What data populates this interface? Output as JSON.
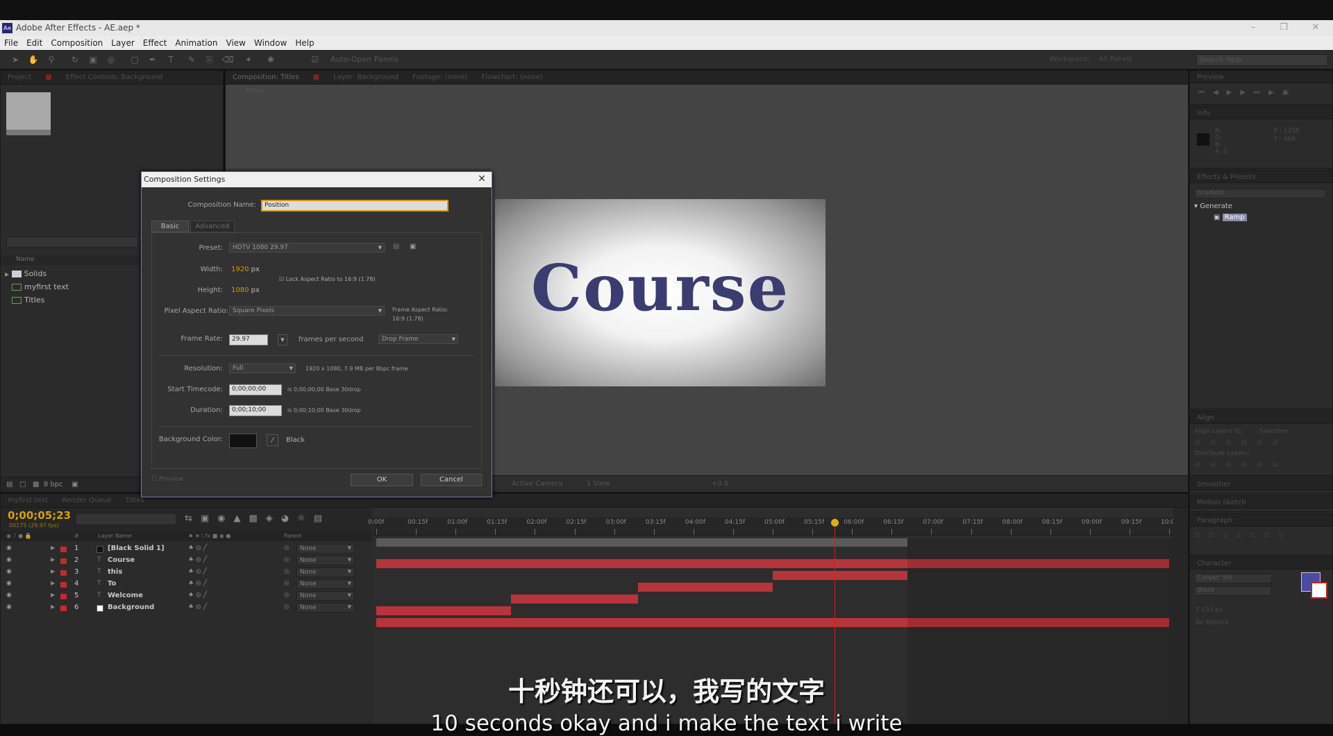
{
  "window": {
    "title": "Adobe After Effects - AE.aep *",
    "app_icon": "Ae"
  },
  "menu": [
    "File",
    "Edit",
    "Composition",
    "Layer",
    "Effect",
    "Animation",
    "View",
    "Window",
    "Help"
  ],
  "toolbar": {
    "auto_open": "Auto-Open Panels",
    "workspace_label": "Workspace:",
    "workspace_value": "All Panels",
    "search_placeholder": "Search Help"
  },
  "project": {
    "tabs": [
      "Project",
      "Effect Controls: Background"
    ],
    "column_name": "Name",
    "items": [
      {
        "name": "Solids",
        "type": "folder"
      },
      {
        "name": "myfirst text",
        "type": "comp"
      },
      {
        "name": "Titles",
        "type": "comp"
      }
    ],
    "bpc": "8 bpc"
  },
  "comp_viewer": {
    "tabs": [
      "Composition: Titles",
      "Layer: Background",
      "Footage: (none)",
      "Flowchart: (none)"
    ],
    "subtab": "Titles",
    "canvas_text": "Course",
    "bottom": {
      "camera": "Active Camera",
      "view": "1 View",
      "offset": "+0.0"
    }
  },
  "right_panels": {
    "preview": "Preview",
    "info": "Info",
    "info_x": "X : 1258",
    "info_y": "Y : 468",
    "effects": "Effects & Presets",
    "effects_search": "Gradient",
    "effects_group": "Generate",
    "effects_item": "Ramp",
    "align": "Align",
    "align_to": "Align Layers to:",
    "align_to_value": "Selection",
    "distribute": "Distribute Layers:",
    "smoother": "Smoother",
    "motion_sketch": "Motion Sketch",
    "paragraph": "Paragraph",
    "character": "Character",
    "char_font": "Cooper Std",
    "char_style": "Black",
    "char_size": "133 px",
    "char_leading": "Metrics",
    "accent": "#4a4aa8"
  },
  "timeline": {
    "tabs": [
      "myfirst text",
      "Render Queue",
      "Titles"
    ],
    "timecode": "0;00;05;23",
    "timecode_sub": "00175 (29.97 fps)",
    "col_layer_name": "Layer Name",
    "col_parent": "Parent",
    "layers": [
      {
        "num": "1",
        "name": "[Black Solid 1]",
        "parent": "None",
        "swatch": "#111111"
      },
      {
        "num": "2",
        "name": "Course",
        "parent": "None",
        "swatch": ""
      },
      {
        "num": "3",
        "name": "this",
        "parent": "None",
        "swatch": ""
      },
      {
        "num": "4",
        "name": "To",
        "parent": "None",
        "swatch": ""
      },
      {
        "num": "5",
        "name": "Welcome",
        "parent": "None",
        "swatch": ""
      },
      {
        "num": "6",
        "name": "Background",
        "parent": "None",
        "swatch": "#ffffff"
      }
    ],
    "ruler": [
      "0:00f",
      "00:15f",
      "01:00f",
      "01:15f",
      "02:00f",
      "02:15f",
      "03:00f",
      "03:15f",
      "04:00f",
      "04:15f",
      "05:00f",
      "05:15f",
      "06:00f",
      "06:15f",
      "07:00f",
      "07:15f",
      "08:00f",
      "08:15f",
      "09:00f",
      "09:15f",
      "10:0"
    ],
    "bars": [
      {
        "layer": 1,
        "start": 0.0,
        "end": 10.0
      },
      {
        "layer": 2,
        "start": 5.0,
        "end": 6.7
      },
      {
        "layer": 3,
        "start": 3.3,
        "end": 5.0
      },
      {
        "layer": 4,
        "start": 1.7,
        "end": 3.3
      },
      {
        "layer": 5,
        "start": 0.0,
        "end": 1.7
      },
      {
        "layer": 6,
        "start": 0.0,
        "end": 10.0
      }
    ],
    "playhead_time": 5.78,
    "work_area_end": 6.7
  },
  "dialog": {
    "title": "Composition Settings",
    "comp_name_label": "Composition Name:",
    "comp_name_value": "Position",
    "tab_basic": "Basic",
    "tab_advanced": "Advanced",
    "preset_label": "Preset:",
    "preset_value": "HDTV 1080 29.97",
    "width_label": "Width:",
    "width_value": "1920",
    "px": "px",
    "lock_label": "Lock Aspect Ratio to 16:9 (1.78)",
    "height_label": "Height:",
    "height_value": "1080",
    "par_label": "Pixel Aspect Ratio:",
    "par_value": "Square Pixels",
    "far_label": "Frame Aspect Ratio:",
    "far_value": "16:9 (1.78)",
    "fr_label": "Frame Rate:",
    "fr_value": "29.97",
    "fps": "frames per second",
    "drop_frame": "Drop Frame",
    "res_label": "Resolution:",
    "res_value": "Full",
    "res_info": "1920 x 1080, 7.9 MB per 8bpc frame",
    "start_label": "Start Timecode:",
    "start_value": "0;00;00;00",
    "start_info": "is 0;00;00;00  Base 30drop",
    "dur_label": "Duration:",
    "dur_value": "0;00;10;00",
    "dur_info": "is 0;00;10;00  Base 30drop",
    "bg_label": "Background Color:",
    "bg_name": "Black",
    "preview": "Preview",
    "ok": "OK",
    "cancel": "Cancel"
  },
  "subtitles": {
    "cn": "十秒钟还可以，我写的文字",
    "en": "10 seconds okay and i make the text i write"
  }
}
